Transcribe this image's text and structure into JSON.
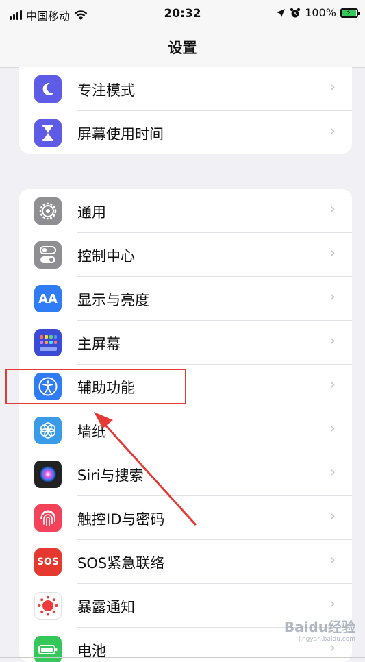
{
  "status_bar": {
    "carrier": "中国移动",
    "time": "20:32",
    "battery_percent": "100%",
    "battery_level": 1.0,
    "icons": [
      "signal-bars-icon",
      "wifi-icon",
      "location-arrow-icon",
      "alarm-icon",
      "battery-charging-icon"
    ]
  },
  "nav": {
    "title": "设置"
  },
  "group1": {
    "items": [
      {
        "label": "专注模式",
        "icon": "moon-icon",
        "color": "#5e5ce6"
      },
      {
        "label": "屏幕使用时间",
        "icon": "hourglass-icon",
        "color": "#5e5ce6"
      }
    ]
  },
  "group2": {
    "items": [
      {
        "label": "通用",
        "icon": "gear-icon",
        "color": "#8e8e93"
      },
      {
        "label": "控制中心",
        "icon": "toggles-icon",
        "color": "#8e8e93"
      },
      {
        "label": "显示与亮度",
        "icon": "text-size-icon",
        "icon_text": "AA",
        "color": "#2f7cf6"
      },
      {
        "label": "主屏幕",
        "icon": "app-grid-icon",
        "color": "#3a4bd6"
      },
      {
        "label": "辅助功能",
        "icon": "accessibility-icon",
        "color": "#2f7cf6"
      },
      {
        "label": "墙纸",
        "icon": "flower-icon",
        "color": "#3a9be8"
      },
      {
        "label": "Siri与搜索",
        "icon": "siri-icon",
        "color": "#222222"
      },
      {
        "label": "触控ID与密码",
        "icon": "fingerprint-icon",
        "color": "#f2435a"
      },
      {
        "label": "SOS紧急联络",
        "icon": "sos-icon",
        "icon_text": "SOS",
        "color": "#e5392f"
      },
      {
        "label": "暴露通知",
        "icon": "exposure-icon",
        "color": "#ffffff"
      },
      {
        "label": "电池",
        "icon": "battery-icon",
        "color": "#34c759"
      }
    ]
  },
  "chevron": "›",
  "annotation": {
    "highlight_color": "#e53935"
  },
  "watermark": {
    "text": "Baidu经验",
    "sub": "jingyan.baidu.com"
  }
}
